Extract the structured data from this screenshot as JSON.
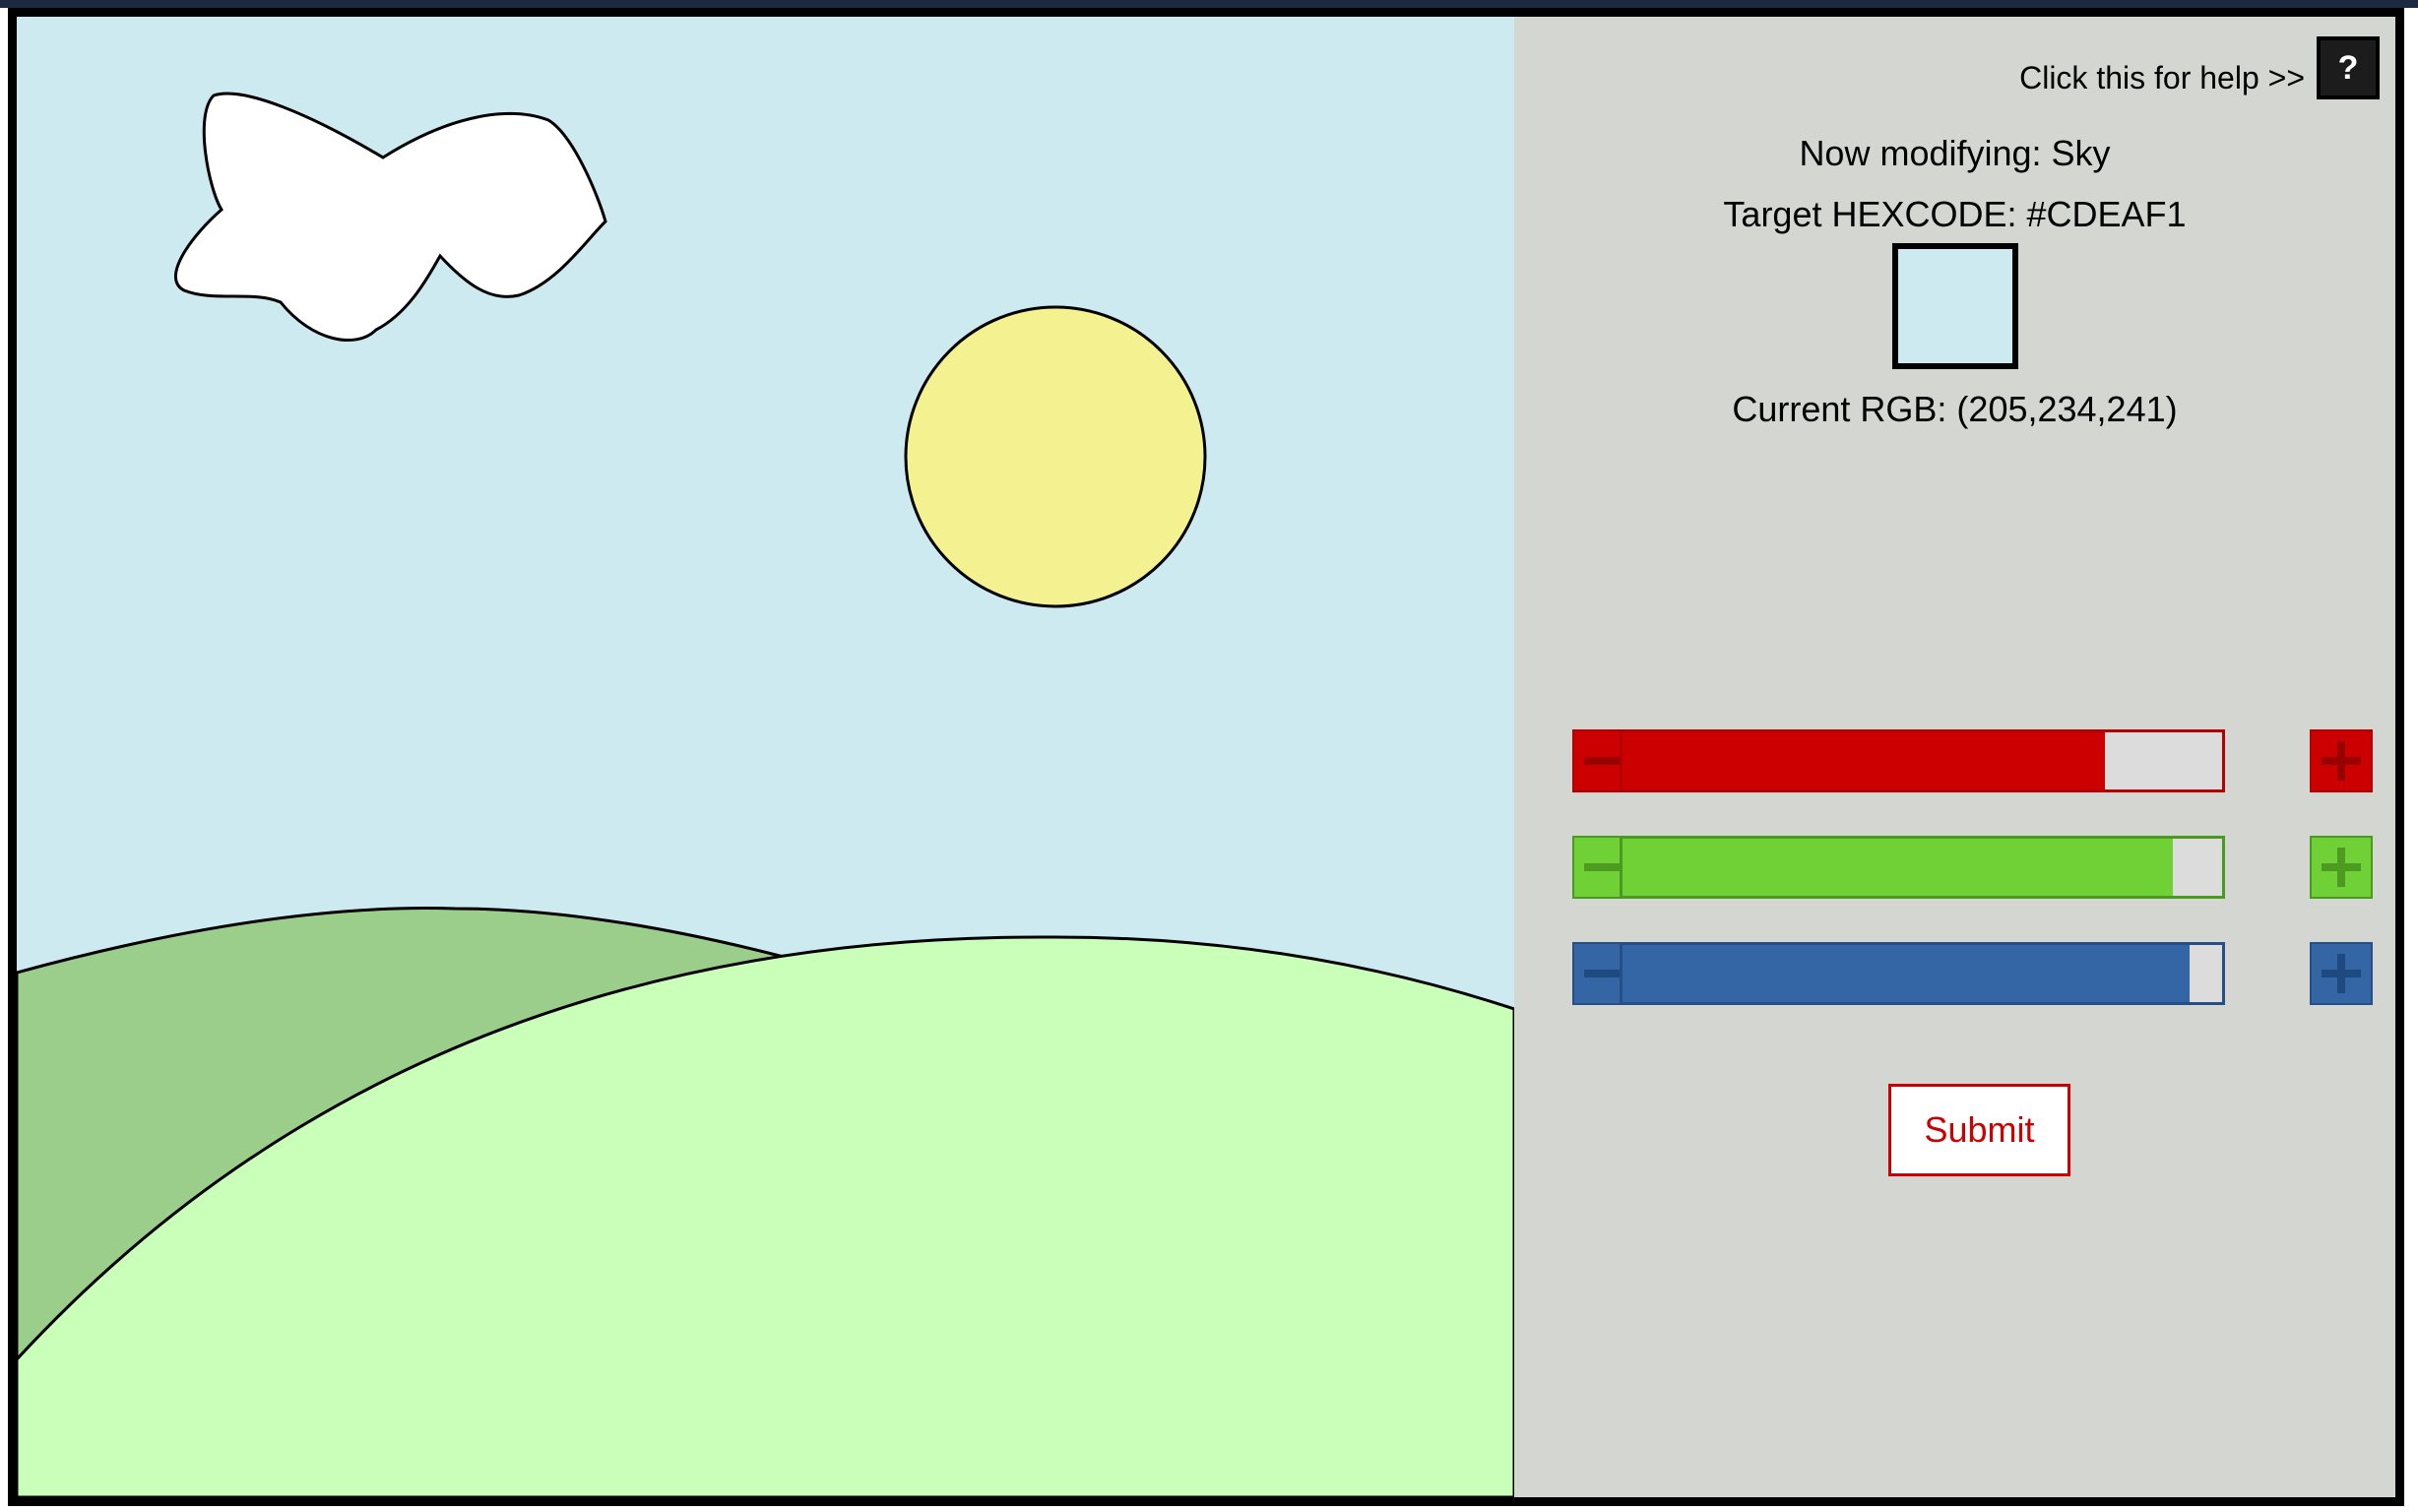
{
  "help": {
    "text": "Click this for help >>",
    "button_label": "?"
  },
  "modifying": {
    "label": "Now modifying: Sky"
  },
  "target": {
    "label": "Target HEXCODE: #CDEAF1",
    "swatch_color": "#CDEAF1"
  },
  "current": {
    "label": "Current RGB: (205,234,241)"
  },
  "sliders": [
    {
      "channel": "red",
      "value": 205,
      "max": 255,
      "color": "#cc0000",
      "border": "#b30000",
      "glyph": "#990000"
    },
    {
      "channel": "green",
      "value": 234,
      "max": 255,
      "color": "#6fd135",
      "border": "#4a9a1f",
      "glyph": "#4e9b22"
    },
    {
      "channel": "blue",
      "value": 241,
      "max": 255,
      "color": "#3465a4",
      "border": "#254f86",
      "glyph": "#1f4a80"
    }
  ],
  "submit": {
    "label": "Submit"
  },
  "scene": {
    "sky_color": "#CDEAF1",
    "sun_color": "#F3F190",
    "cloud_color": "#FFFFFF",
    "back_hill_color": "#9CCE8B",
    "front_hill_color": "#C9FFB9"
  }
}
